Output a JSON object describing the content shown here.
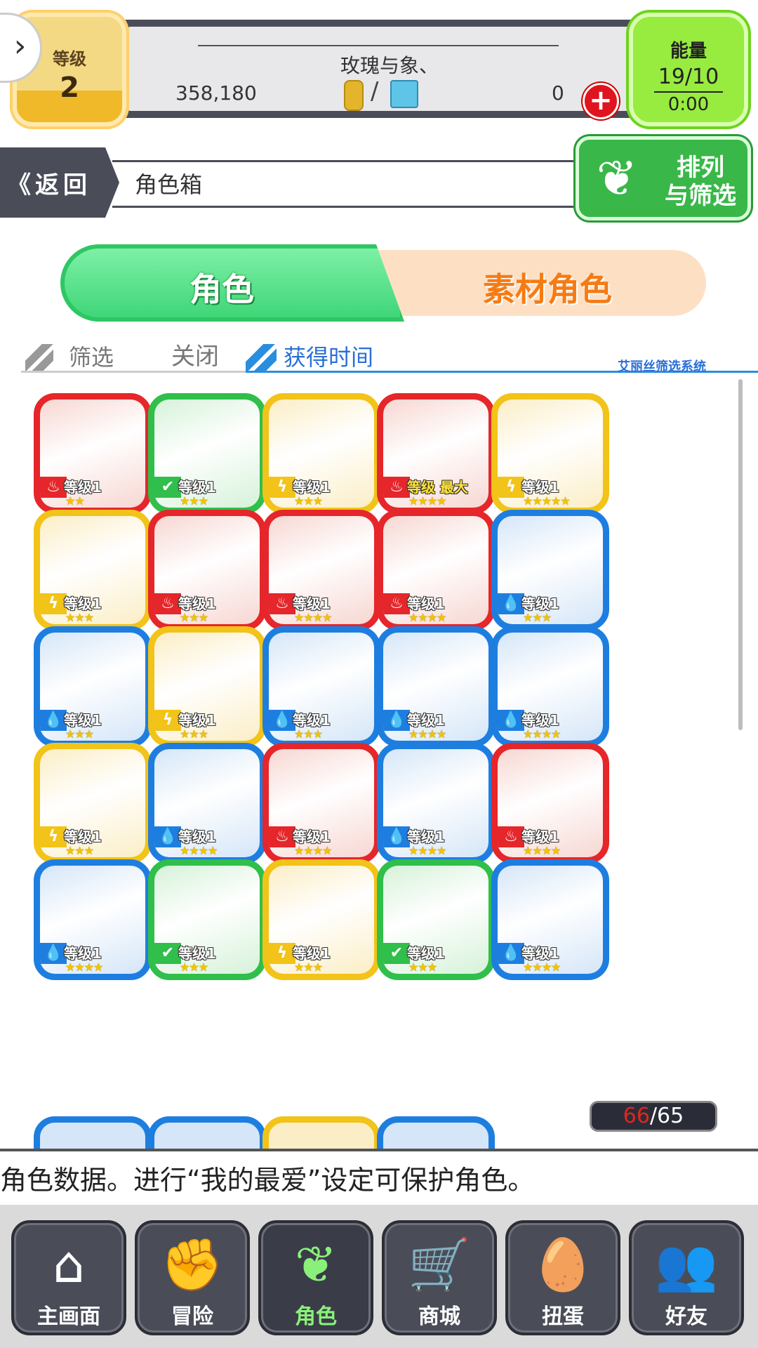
{
  "player": {
    "level_label": "等级",
    "level": "2",
    "name": "玫瑰与象、",
    "coins": "358,180",
    "gems": "0"
  },
  "energy": {
    "label": "能量",
    "value": "19/10",
    "timer": "0:00"
  },
  "header": {
    "back_label": "返回",
    "title": "角色箱",
    "sort_label_1": "排列",
    "sort_label_2": "与筛选"
  },
  "tabs": {
    "characters": "角色",
    "materials": "素材角色"
  },
  "filter": {
    "filter_label": "筛选",
    "filter_value": "关闭",
    "sort_value": "获得时间",
    "system_label": "艾丽丝筛选系统"
  },
  "grid": {
    "cards": [
      {
        "element": "fire",
        "level": "等级1",
        "stars": "★★",
        "is_max": false
      },
      {
        "element": "wood",
        "level": "等级1",
        "stars": "★★★",
        "is_max": false
      },
      {
        "element": "thunder",
        "level": "等级1",
        "stars": "★★★",
        "is_max": false
      },
      {
        "element": "fire",
        "level": "等级 最大",
        "stars": "★★★★",
        "is_max": true
      },
      {
        "element": "thunder",
        "level": "等级1",
        "stars": "★★★★★",
        "is_max": false
      },
      {
        "element": "thunder",
        "level": "等级1",
        "stars": "★★★",
        "is_max": false
      },
      {
        "element": "fire",
        "level": "等级1",
        "stars": "★★★",
        "is_max": false
      },
      {
        "element": "fire",
        "level": "等级1",
        "stars": "★★★★",
        "is_max": false
      },
      {
        "element": "fire",
        "level": "等级1",
        "stars": "★★★★",
        "is_max": false
      },
      {
        "element": "water",
        "level": "等级1",
        "stars": "★★★",
        "is_max": false
      },
      {
        "element": "water",
        "level": "等级1",
        "stars": "★★★",
        "is_max": false
      },
      {
        "element": "thunder",
        "level": "等级1",
        "stars": "★★★",
        "is_max": false
      },
      {
        "element": "water",
        "level": "等级1",
        "stars": "★★★",
        "is_max": false
      },
      {
        "element": "water",
        "level": "等级1",
        "stars": "★★★★",
        "is_max": false
      },
      {
        "element": "water",
        "level": "等级1",
        "stars": "★★★★",
        "is_max": false
      },
      {
        "element": "thunder",
        "level": "等级1",
        "stars": "★★★",
        "is_max": false
      },
      {
        "element": "water",
        "level": "等级1",
        "stars": "★★★★",
        "is_max": false
      },
      {
        "element": "fire",
        "level": "等级1",
        "stars": "★★★★",
        "is_max": false
      },
      {
        "element": "water",
        "level": "等级1",
        "stars": "★★★★",
        "is_max": false
      },
      {
        "element": "fire",
        "level": "等级1",
        "stars": "★★★★",
        "is_max": false
      },
      {
        "element": "water",
        "level": "等级1",
        "stars": "★★★★",
        "is_max": false
      },
      {
        "element": "wood",
        "level": "等级1",
        "stars": "★★★",
        "is_max": false
      },
      {
        "element": "thunder",
        "level": "等级1",
        "stars": "★★★",
        "is_max": false
      },
      {
        "element": "wood",
        "level": "等级1",
        "stars": "★★★",
        "is_max": false
      },
      {
        "element": "water",
        "level": "等级1",
        "stars": "★★★★",
        "is_max": false
      }
    ],
    "partial_row_elements": [
      "water",
      "water",
      "thunder",
      "water"
    ]
  },
  "box_count": {
    "current": "66",
    "max": "/65"
  },
  "info_text": "角色数据。进行“我的最爱”设定可保护角色。",
  "nav": [
    {
      "label": "主画面",
      "icon": "home-icon",
      "glyph": "⌂"
    },
    {
      "label": "冒险",
      "icon": "handshake-icon",
      "glyph": "✊"
    },
    {
      "label": "角色",
      "icon": "bunny-icon",
      "glyph": "❦"
    },
    {
      "label": "商城",
      "icon": "cart-icon",
      "glyph": "🛒"
    },
    {
      "label": "扭蛋",
      "icon": "egg-icon",
      "glyph": "🥚"
    },
    {
      "label": "好友",
      "icon": "friends-icon",
      "glyph": "👥"
    }
  ],
  "colors": {
    "fire": "#e5262a",
    "water": "#1e7ee0",
    "thunder": "#f2c318",
    "wood": "#2fbf4a",
    "accent_green": "#3fd678",
    "accent_orange": "#f57b14"
  }
}
